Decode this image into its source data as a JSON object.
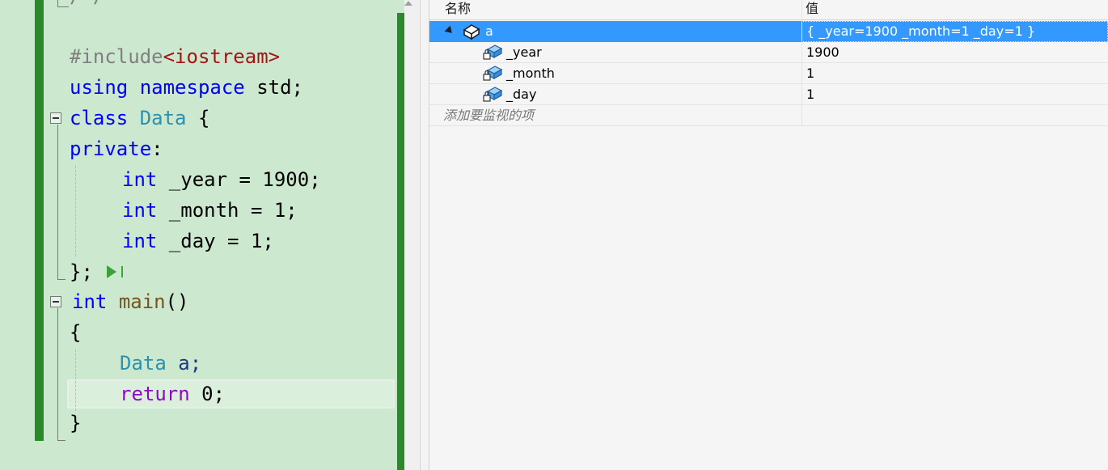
{
  "editor": {
    "lines": {
      "include_directive": "#include",
      "include_target": "<iostream>",
      "using_kw": "using",
      "namespace_kw": "namespace",
      "using_rest": " std;",
      "class_kw": "class",
      "class_name": "Data",
      "class_brace": " {",
      "private_kw": "private",
      "private_colon": ":",
      "int1": "int",
      "member1": " _year = 1900;",
      "int2": "int",
      "member2": " _month = 1;",
      "int3": "int",
      "member3": " _day = 1;",
      "class_end": "};",
      "main_int": "int",
      "main_name": "main",
      "main_parens": "()",
      "open_brace": "{",
      "var_type": "Data",
      "var_rest": " a;",
      "return_kw": "return",
      "return_rest": " 0;",
      "close_brace": "}"
    }
  },
  "watch": {
    "header_name": "名称",
    "header_value": "值",
    "rows": [
      {
        "name": "a",
        "value": "{ _year=1900 _month=1 _day=1 }"
      },
      {
        "name": "_year",
        "value": "1900"
      },
      {
        "name": "_month",
        "value": "1"
      },
      {
        "name": "_day",
        "value": "1"
      }
    ],
    "add_placeholder": "添加要监视的项"
  },
  "colors": {
    "editor_bg": "#cce8cf",
    "change_bar": "#2a8a2a",
    "selection": "#3399ff"
  }
}
